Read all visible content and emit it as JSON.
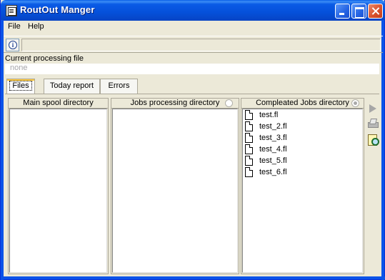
{
  "window": {
    "title": "RoutOut Manger"
  },
  "menu": {
    "items": [
      "File",
      "Help"
    ]
  },
  "toolbar": {
    "info_icon": "info-icon"
  },
  "processing": {
    "label": "Current processing file",
    "value": "none"
  },
  "tabs": [
    {
      "label": "Files",
      "selected": true
    },
    {
      "label": "Today report",
      "selected": false
    },
    {
      "label": "Errors",
      "selected": false
    }
  ],
  "panels": {
    "main_spool": {
      "title": "Main spool directory",
      "files": []
    },
    "jobs_processing": {
      "title": "Jobs processing directory",
      "radio_checked": false,
      "files": []
    },
    "completed_jobs": {
      "title": "Compleated Jobs directory",
      "radio_checked": true,
      "files": [
        "test.fl",
        "test_2.fl",
        "test_3.fl",
        "test_4.fl",
        "test_5.fl",
        "test_6.fl"
      ]
    }
  },
  "side_tools": [
    "play-icon",
    "print-icon",
    "find-icon"
  ],
  "colors": {
    "titlebar": "#0550DA",
    "face": "#ECE9D8",
    "border": "#0A53E8"
  }
}
